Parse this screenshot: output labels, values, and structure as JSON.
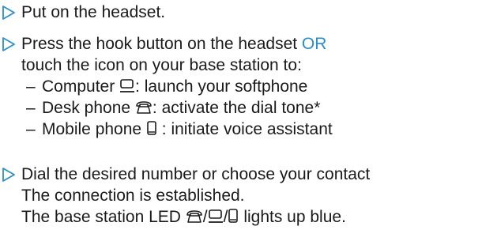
{
  "steps": [
    {
      "lines": [
        "Put on the headset."
      ]
    },
    {
      "line1_before_or": "Press the hook button on the headset ",
      "line1_or": "OR",
      "line2": "touch the icon on your base station to:",
      "items": [
        {
          "label": "Computer",
          "icon": "computer-icon",
          "text": ":  launch your softphone"
        },
        {
          "label": "Desk phone",
          "icon": "desk-phone-icon",
          "text": ": activate the dial tone*"
        },
        {
          "label": "Mobile phone",
          "icon": "mobile-phone-icon",
          "text": " : initiate voice assistant"
        }
      ]
    },
    {
      "lines": [
        "Dial the desired number or choose your contact",
        "The connection is established."
      ],
      "last_line_before": "The base station LED ",
      "last_line_sep": "/",
      "last_line_after": " lights up blue."
    }
  ],
  "colors": {
    "arrow": "#2b8ec8",
    "text": "#1a1a1a",
    "or": "#2b8ec8"
  },
  "dash": "–"
}
